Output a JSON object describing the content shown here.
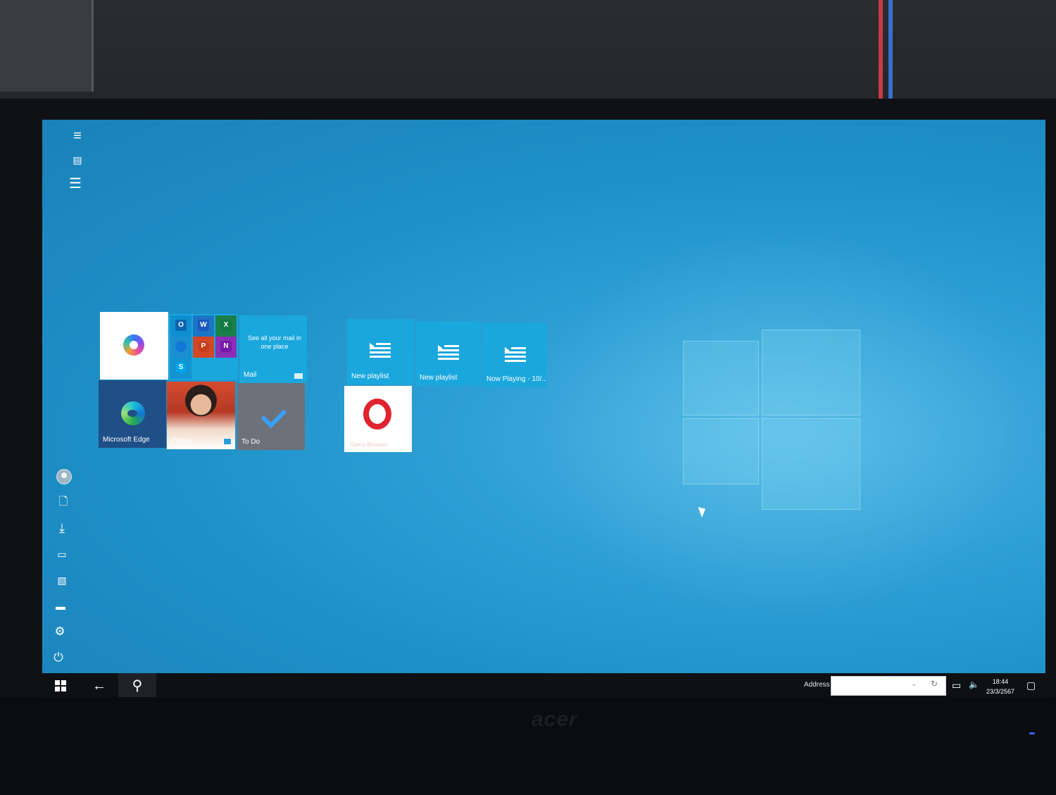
{
  "start_menu": {
    "rail_top_icons": [
      "hamburger-menu-icon",
      "tiles-view-icon",
      "all-apps-list-icon"
    ],
    "rail_bottom_icons": [
      "user-avatar-icon",
      "documents-icon",
      "downloads-icon",
      "videos-icon",
      "pictures-icon",
      "file-explorer-icon",
      "settings-gear-icon",
      "power-icon"
    ],
    "tiles_group1": {
      "copilot": {
        "label": ""
      },
      "office_minis": [
        "outlook",
        "word",
        "excel",
        "onedrive",
        "powerpoint",
        "onenote",
        "skype"
      ],
      "office_mini_letters": {
        "outlook": "O",
        "word": "W",
        "excel": "X",
        "powerpoint": "P",
        "onenote": "N",
        "skype": "S"
      },
      "mail": {
        "label": "Mail",
        "text": "See all your mail in one place"
      },
      "edge": {
        "label": "Microsoft Edge"
      },
      "photos": {
        "label": "Photos"
      },
      "todo": {
        "label": "To Do"
      }
    },
    "tiles_group2": {
      "playlist1": {
        "label": "New playlist"
      },
      "playlist2": {
        "label": "New playlist"
      },
      "now_playing": {
        "label": "Now Playing - 10/..."
      },
      "opera": {
        "label": "Opera Browser"
      }
    }
  },
  "taskbar": {
    "start_icon": "windows-logo-icon",
    "back_icon": "←",
    "search_icon": "⚲",
    "address_label": "Address",
    "address_value": "",
    "address_dropdown": "⌄",
    "address_refresh": "↻",
    "tray": {
      "network": "▭",
      "volume": "🔈"
    },
    "clock_time": "18:44",
    "clock_date": "23/3/2567",
    "notifications_icon": "▢"
  },
  "colors": {
    "desktop": "#1e90c8",
    "tile_blue": "#1aa7dd",
    "tile_dark": "#1f4f86",
    "todo": "#6d7179",
    "opera_red": "#e0232e",
    "taskbar": "#0e1014"
  },
  "monitor_brand": "acer"
}
